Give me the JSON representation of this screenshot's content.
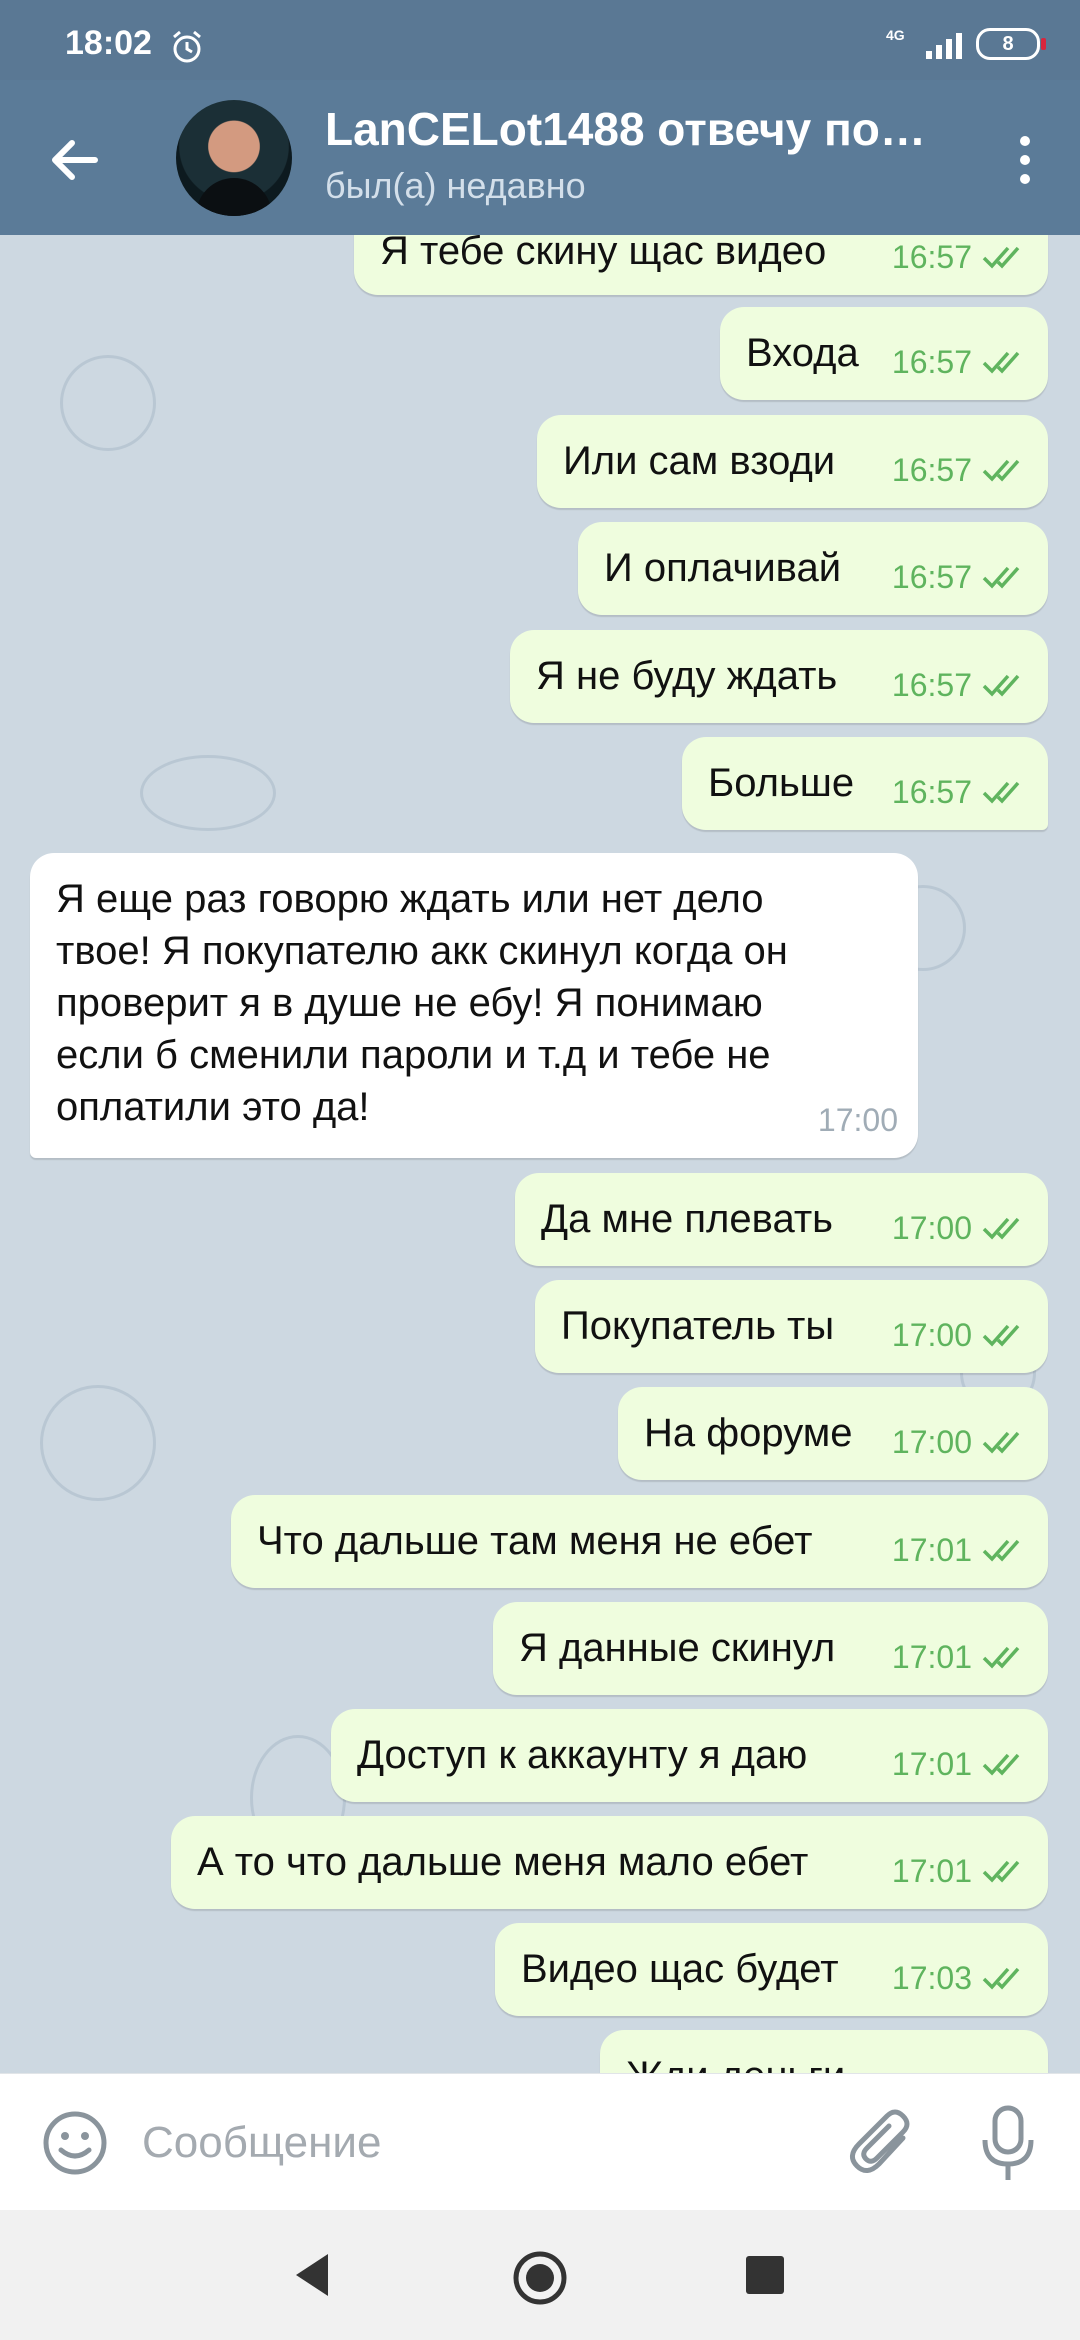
{
  "status_bar": {
    "time": "18:02",
    "network": "4G",
    "battery": "8"
  },
  "header": {
    "contact_name": "LanCELot1488 отвечу по…",
    "contact_status": "был(а) недавно"
  },
  "messages": [
    {
      "dir": "out",
      "text": "Я тебе скину щас видео",
      "time": "16:57"
    },
    {
      "dir": "out",
      "text": "Входа",
      "time": "16:57"
    },
    {
      "dir": "out",
      "text": "Или сам взоди",
      "time": "16:57"
    },
    {
      "dir": "out",
      "text": "И оплачивай",
      "time": "16:57"
    },
    {
      "dir": "out",
      "text": "Я не буду ждать",
      "time": "16:57"
    },
    {
      "dir": "out",
      "text": "Больше",
      "time": "16:57"
    },
    {
      "dir": "in",
      "lines": [
        "Я еще раз говорю ждать или нет дело",
        "твое! Я покупателю акк скинул когда он",
        "проверит я в душе не ебу! Я понимаю",
        "если б сменили пароли и т.д и тебе не",
        "оплатили это да!"
      ],
      "time": "17:00"
    },
    {
      "dir": "out",
      "text": "Да мне плевать",
      "time": "17:00"
    },
    {
      "dir": "out",
      "text": "Покупатель ты",
      "time": "17:00"
    },
    {
      "dir": "out",
      "text": "На форуме",
      "time": "17:00"
    },
    {
      "dir": "out",
      "text": "Что дальше там меня не ебет",
      "time": "17:01"
    },
    {
      "dir": "out",
      "text": "Я данные скинул",
      "time": "17:01"
    },
    {
      "dir": "out",
      "text": "Доступ к аккаунту я даю",
      "time": "17:01"
    },
    {
      "dir": "out",
      "text": "А то что дальше меня мало ебет",
      "time": "17:01"
    },
    {
      "dir": "out",
      "text": "Видео щас будет",
      "time": "17:03"
    },
    {
      "dir": "out",
      "text": "Жди деньги",
      "time": ""
    }
  ],
  "composer": {
    "placeholder": "Сообщение"
  },
  "icons": {
    "back": "arrow-left-icon",
    "menu": "more-vertical-icon",
    "emoji": "smile-icon",
    "attach": "paperclip-icon",
    "mic": "microphone-icon",
    "read": "double-check-icon"
  },
  "colors": {
    "header": "#5b7b98",
    "outgoing_bubble": "#effdde",
    "incoming_bubble": "#ffffff",
    "check": "#5fb45e"
  }
}
